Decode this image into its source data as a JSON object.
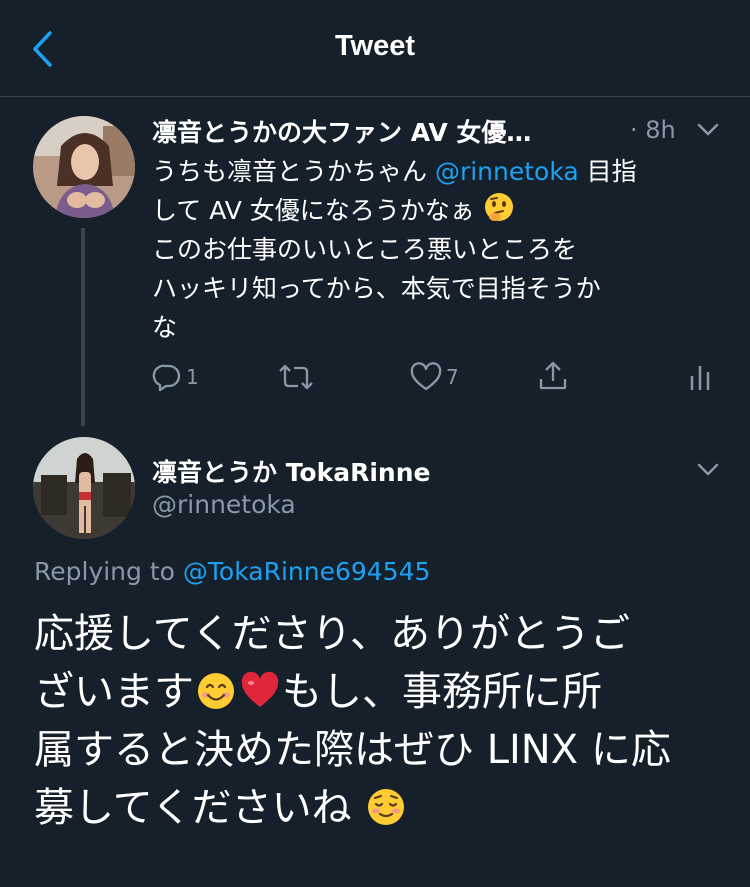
{
  "header": {
    "title": "Tweet"
  },
  "tweet1": {
    "display_name": "凛音とうかの大ファン AV 女優…",
    "time": "· 8h",
    "body_line1_pre": "うちも凛音とうかちゃん ",
    "body_mention": "@rinnetoka",
    "body_line1_post": " 目指",
    "body_line2": "して AV 女優になろうかなぁ",
    "body_line3": "このお仕事のいいところ悪いところを",
    "body_line4": "ハッキリ知ってから、本気で目指そうか",
    "body_line5": "な",
    "reply_count": "1",
    "retweet_count": "",
    "like_count": "7"
  },
  "tweet2": {
    "display_name": "凛音とうか TokaRinne",
    "handle": "@rinnetoka",
    "replying_label": "Replying to ",
    "replying_to": "@TokaRinne694545",
    "body_line1": "応援してくださり、ありがとうご",
    "body_line2_a": "ざいます",
    "body_line2_b": "もし、事務所に所",
    "body_line3": "属すると決めた際はぜひ LINX に応",
    "body_line4": "募してくださいね"
  },
  "colors": {
    "background": "#15202b",
    "accent": "#1da1f2",
    "muted": "#8899a6",
    "divider": "#38444d"
  },
  "icons": [
    "back-chevron-icon",
    "chevron-down-icon",
    "reply-icon",
    "retweet-icon",
    "like-icon",
    "share-icon",
    "analytics-icon",
    "thinking-face-emoji",
    "smiling-face-emoji",
    "red-heart-emoji",
    "relieved-smile-emoji"
  ]
}
